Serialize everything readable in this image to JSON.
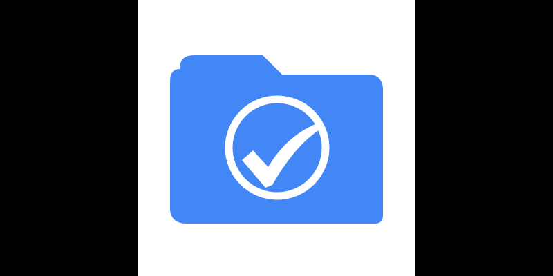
{
  "colors": {
    "backdrop": "#000000",
    "card_background": "#ffffff",
    "folder_fill": "#4287f5",
    "badge_stroke": "#ffffff",
    "checkmark_fill": "#ffffff"
  },
  "icon": {
    "name": "folder-check-icon",
    "parts": [
      "folder-icon",
      "circle-check-icon"
    ]
  }
}
